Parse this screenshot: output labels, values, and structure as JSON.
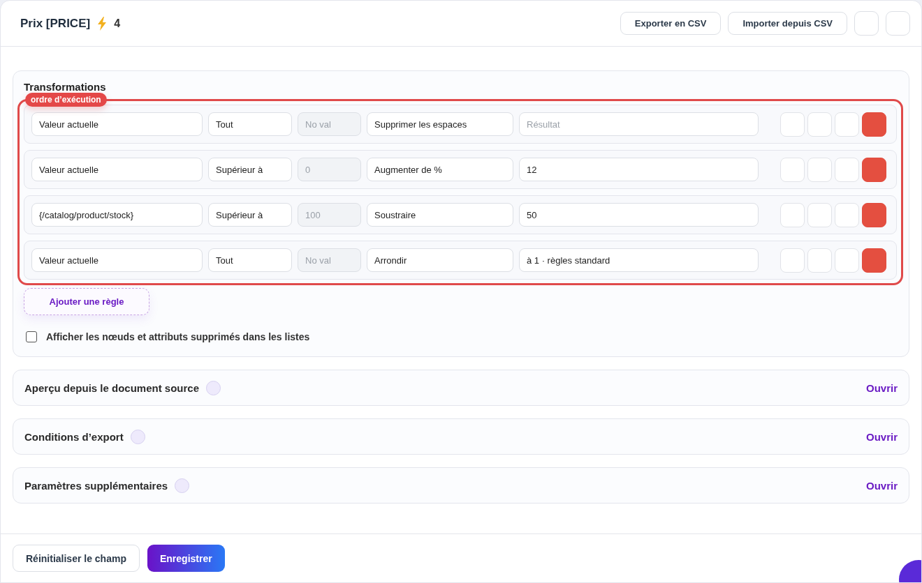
{
  "header": {
    "title": "Prix [PRICE]",
    "count": "4",
    "buttons": [
      "Exporter en CSV",
      "Importer depuis CSV"
    ]
  },
  "transformations": {
    "title": "Transformations",
    "badge": "ordre d’exécution",
    "rules": [
      {
        "source": "Valeur actuelle",
        "condition": "Tout",
        "operand": {
          "placeholder": "No val",
          "disabled": true
        },
        "action": "Supprimer les espaces",
        "result": {
          "placeholder": "Résultat"
        }
      },
      {
        "source": "Valeur actuelle",
        "condition": "Supérieur à",
        "operand": {
          "placeholder": "0",
          "disabled": true
        },
        "action": "Augmenter de %",
        "result": {
          "value": "12"
        }
      },
      {
        "source": "{/catalog/product/stock}",
        "condition": "Supérieur à",
        "operand": {
          "placeholder": "100",
          "disabled": true
        },
        "action": "Soustraire",
        "result": {
          "value": "50"
        }
      },
      {
        "source": "Valeur actuelle",
        "condition": "Tout",
        "operand": {
          "placeholder": "No val",
          "disabled": true
        },
        "action": "Arrondir",
        "result": {
          "value": "à 1 · règles standard"
        }
      }
    ],
    "add_button": "Ajouter une règle",
    "checkbox": {
      "label": "Afficher les nœuds et attributs supprimés dans les listes",
      "checked": false
    }
  },
  "sections": [
    {
      "title": "Aperçu depuis le document source",
      "action": "Ouvrir"
    },
    {
      "title": "Conditions d’export",
      "action": "Ouvrir"
    },
    {
      "title": "Paramètres supplémentaires",
      "action": "Ouvrir"
    }
  ],
  "footer": {
    "reset": "Réinitialiser le champ",
    "save": "Enregistrer"
  }
}
